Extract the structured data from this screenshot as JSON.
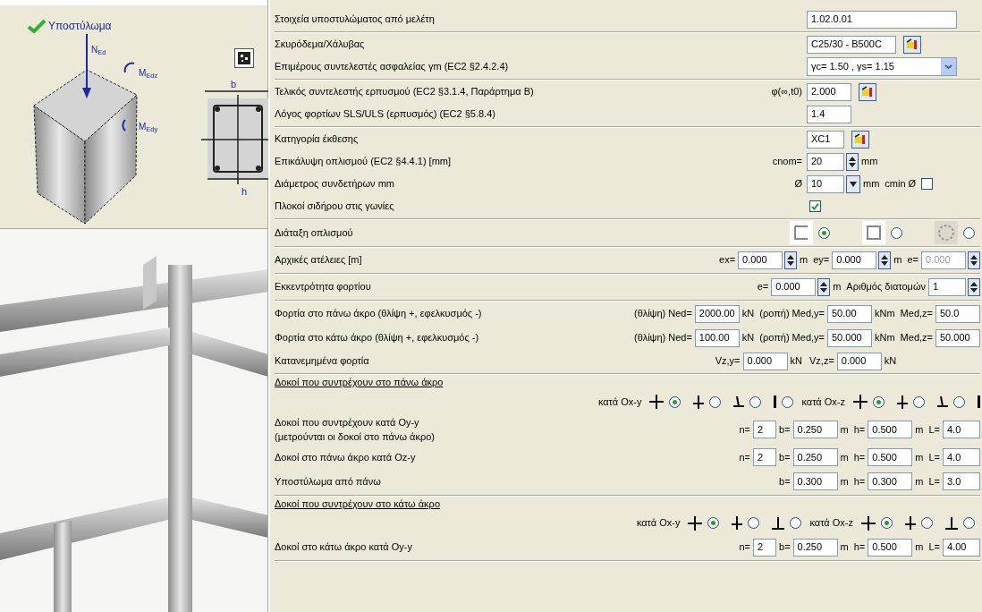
{
  "left_panel": {
    "title": "Υποστύλωμα",
    "drawing_labels": [
      "N$_{Ed}$",
      "M$_{Edz}$",
      "M$_{Edy}$"
    ],
    "section_labels": [
      "b",
      "h"
    ]
  },
  "groups": [
    {
      "rows": [
        {
          "kind": "setting",
          "label": "Στοιχεία υποστυλώματος από μελέτη",
          "pre": [],
          "main": [
            {
              "kind": "long_field",
              "value": "1.02.0.01",
              "disabled": false
            }
          ]
        }
      ]
    },
    {
      "rows": [
        {
          "kind": "setting",
          "label": "Σκυρόδεμα/Χάλυβας",
          "pre": [],
          "main": [
            {
              "kind": "medium_field",
              "value": "C25/30 - B500C",
              "disabled": false
            },
            {
              "kind": "button"
            }
          ]
        },
        {
          "kind": "setting",
          "label": "Επιμέρους συντελεστές ασφαλείας γm (EC2 §2.4.2.4)",
          "pre": [],
          "main": [
            {
              "kind": "dropdown",
              "value": "γc= 1.50 , γs= 1.15"
            }
          ]
        }
      ]
    },
    {
      "rows": [
        {
          "kind": "setting",
          "label": "Τελικός συντελεστής ερπυσμού (EC2 §3.1.4, Παράρτημα Β)",
          "pre": [
            {
              "kind": "text",
              "text": "φ(∞,t0)"
            }
          ],
          "main": [
            {
              "kind": "field",
              "value": "2.000",
              "disabled": false
            },
            {
              "kind": "button"
            }
          ]
        },
        {
          "kind": "setting",
          "label": "Λόγος φορτίων SLS/ULS (ερπυσμός) (EC2 §5.8.4)",
          "pre": [],
          "main": [
            {
              "kind": "field",
              "value": "1.4",
              "disabled": false
            }
          ]
        }
      ]
    },
    {
      "rows": [
        {
          "kind": "setting",
          "label": "Κατηγορία έκθεσης",
          "pre": [],
          "main": [
            {
              "kind": "short_field",
              "value": "XC1",
              "disabled": false
            },
            {
              "kind": "button"
            }
          ]
        },
        {
          "kind": "setting",
          "label": "Επικάλυψη οπλισμού (EC2 §4.4.1) [mm]",
          "pre": [
            {
              "kind": "text",
              "text": "cnom="
            }
          ],
          "main": [
            {
              "kind": "short_field",
              "value": "20",
              "disabled": false
            },
            {
              "kind": "spinner"
            },
            {
              "kind": "text",
              "text": "mm"
            }
          ]
        },
        {
          "kind": "setting",
          "label": "Διάμετρος συνδετήρων mm",
          "pre": [
            {
              "kind": "text",
              "text": "Ø"
            }
          ],
          "main": [
            {
              "kind": "short_field",
              "value": "10",
              "disabled": false
            },
            {
              "kind": "dropdown_button"
            },
            {
              "kind": "text",
              "text": "mm"
            },
            {
              "kind": "text",
              "text": "cmin Ø"
            },
            {
              "kind": "checkbox",
              "checked": false
            }
          ]
        },
        {
          "kind": "setting",
          "label": "Πλοκοί σιδήρου στις γωνίες",
          "pre": [],
          "main": [
            {
              "kind": "checkbox",
              "checked": true
            }
          ]
        }
      ]
    },
    {
      "rows": [
        {
          "kind": "wide",
          "label": "Διάταξη οπλισμού",
          "controls": [
            {
              "kind": "corner_layout"
            },
            {
              "kind": "radio",
              "selected": true
            },
            {
              "kind": "rect_layout"
            },
            {
              "kind": "radio",
              "selected": false
            },
            {
              "kind": "round_layout"
            },
            {
              "kind": "radio",
              "selected": false
            }
          ]
        }
      ]
    },
    {
      "rows": [
        {
          "kind": "wide",
          "label": "Αρχικές ατέλειες [m]",
          "controls": [
            {
              "kind": "text",
              "text": "ex="
            },
            {
              "kind": "field",
              "value": "0.000",
              "disabled": false
            },
            {
              "kind": "spinner"
            },
            {
              "kind": "text",
              "text": "m"
            },
            {
              "kind": "text",
              "text": "ey="
            },
            {
              "kind": "field",
              "value": "0.000",
              "disabled": false
            },
            {
              "kind": "spinner"
            },
            {
              "kind": "text",
              "text": "m"
            },
            {
              "kind": "text",
              "text": "e="
            },
            {
              "kind": "field",
              "value": "0.000",
              "disabled": true
            },
            {
              "kind": "spinner"
            }
          ]
        }
      ]
    },
    {
      "rows": [
        {
          "kind": "wide",
          "label": "Εκκεντρότητα φορτίου",
          "controls": [
            {
              "kind": "text",
              "text": "e="
            },
            {
              "kind": "field",
              "value": "0.000",
              "disabled": false
            },
            {
              "kind": "spinner"
            },
            {
              "kind": "text",
              "text": "m"
            },
            {
              "kind": "text",
              "text": "Αριθμός διατομών"
            },
            {
              "kind": "short_field",
              "value": "1",
              "disabled": false
            },
            {
              "kind": "spinner"
            }
          ]
        }
      ]
    },
    {
      "rows": [
        {
          "kind": "wide",
          "label": "Φορτία στο πάνω άκρο (θλίψη +, εφελκυσμός -)",
          "controls": [
            {
              "kind": "text",
              "text": "(θλίψη) Ned="
            },
            {
              "kind": "field",
              "value": "2000.00",
              "disabled": false
            },
            {
              "kind": "text",
              "text": "kN"
            },
            {
              "kind": "text",
              "text": "(ροπή) Med,y="
            },
            {
              "kind": "field",
              "value": "50.00",
              "disabled": false
            },
            {
              "kind": "text",
              "text": "kNm"
            },
            {
              "kind": "text",
              "text": "Med,z="
            },
            {
              "kind": "field",
              "value": "50.0",
              "disabled": false
            }
          ]
        },
        {
          "kind": "wide",
          "label": "Φορτία στο κάτω άκρο (θλίψη +, εφελκυσμός -)",
          "controls": [
            {
              "kind": "text",
              "text": "(θλίψη) Ned="
            },
            {
              "kind": "field",
              "value": "100.00",
              "disabled": false
            },
            {
              "kind": "text",
              "text": "kN"
            },
            {
              "kind": "text",
              "text": "(ροπή) Med,y="
            },
            {
              "kind": "field",
              "value": "50.000",
              "disabled": false
            },
            {
              "kind": "text",
              "text": "kNm"
            },
            {
              "kind": "text",
              "text": "Med,z="
            },
            {
              "kind": "field",
              "value": "50.000",
              "disabled": false
            }
          ]
        },
        {
          "kind": "setting",
          "label": "Κατανεμημένα φορτία",
          "pre": [
            {
              "kind": "text",
              "text": "Vz,y="
            },
            {
              "kind": "field",
              "value": "0.000",
              "disabled": false
            },
            {
              "kind": "text",
              "text": "kN"
            }
          ],
          "main": [
            {
              "kind": "text",
              "text": "Vz,z="
            },
            {
              "kind": "field",
              "value": "0.000",
              "disabled": false
            },
            {
              "kind": "text",
              "text": "kN"
            }
          ]
        }
      ]
    },
    {
      "heading": "Δοκοί που συντρέχουν στο πάνω άκρο",
      "rows": [
        {
          "kind": "wide",
          "controls": [
            {
              "kind": "text",
              "text": "κατά Ox-y"
            },
            {
              "kind": "cross_symbol"
            },
            {
              "kind": "radio",
              "selected": true
            },
            {
              "kind": "tee_symbol"
            },
            {
              "kind": "radio",
              "selected": false
            },
            {
              "kind": "slant_tee_symbol"
            },
            {
              "kind": "radio",
              "selected": false
            },
            {
              "kind": "bar_symbol"
            },
            {
              "kind": "radio",
              "selected": false
            },
            {
              "kind": "text",
              "text": "κατά Ox-z"
            },
            {
              "kind": "cross_symbol"
            },
            {
              "kind": "radio",
              "selected": true
            },
            {
              "kind": "tee_symbol"
            },
            {
              "kind": "radio",
              "selected": false
            },
            {
              "kind": "slant_tee_symbol"
            },
            {
              "kind": "radio",
              "selected": false
            },
            {
              "kind": "bar_symbol"
            }
          ]
        },
        {
          "kind": "wide",
          "label": "Δοκοί που συντρέχουν κατά Oy-y",
          "note": "(μετρούνται οι δοκοί στο πάνω άκρο)",
          "controls": [
            {
              "kind": "text",
              "text": "n="
            },
            {
              "kind": "tiny_field",
              "value": "2",
              "disabled": false
            },
            {
              "kind": "text",
              "text": "b="
            },
            {
              "kind": "field",
              "value": "0.250",
              "disabled": false
            },
            {
              "kind": "text",
              "text": "m"
            },
            {
              "kind": "text",
              "text": "h="
            },
            {
              "kind": "field",
              "value": "0.500",
              "disabled": false
            },
            {
              "kind": "text",
              "text": "m"
            },
            {
              "kind": "text",
              "text": "L="
            },
            {
              "kind": "short_field",
              "value": "4.0",
              "disabled": false
            }
          ]
        },
        {
          "kind": "wide",
          "label": "Δοκοί στο πάνω άκρο κατά Oz-y",
          "controls": [
            {
              "kind": "text",
              "text": "n="
            },
            {
              "kind": "tiny_field",
              "value": "2",
              "disabled": false
            },
            {
              "kind": "text",
              "text": "b="
            },
            {
              "kind": "field",
              "value": "0.250",
              "disabled": false
            },
            {
              "kind": "text",
              "text": "m"
            },
            {
              "kind": "text",
              "text": "h="
            },
            {
              "kind": "field",
              "value": "0.500",
              "disabled": false
            },
            {
              "kind": "text",
              "text": "m"
            },
            {
              "kind": "text",
              "text": "L="
            },
            {
              "kind": "short_field",
              "value": "4.0",
              "disabled": false
            }
          ]
        },
        {
          "kind": "wide",
          "label": "Υποστύλωμα από πάνω",
          "controls": [
            {
              "kind": "text",
              "text": "b="
            },
            {
              "kind": "field",
              "value": "0.300",
              "disabled": false
            },
            {
              "kind": "text",
              "text": "m"
            },
            {
              "kind": "text",
              "text": "h="
            },
            {
              "kind": "field",
              "value": "0.300",
              "disabled": false
            },
            {
              "kind": "text",
              "text": "m"
            },
            {
              "kind": "text",
              "text": "L="
            },
            {
              "kind": "short_field",
              "value": "3.0",
              "disabled": false
            }
          ]
        }
      ]
    },
    {
      "heading": "Δοκοί που συντρέχουν στο κάτω άκρο",
      "rows": [
        {
          "kind": "wide",
          "controls": [
            {
              "kind": "text",
              "text": "κατά Ox-y"
            },
            {
              "kind": "cross_symbol"
            },
            {
              "kind": "radio",
              "selected": true
            },
            {
              "kind": "tee_symbol"
            },
            {
              "kind": "radio",
              "selected": false
            },
            {
              "kind": "inverted_tee_symbol"
            },
            {
              "kind": "radio",
              "selected": false
            },
            {
              "kind": "text",
              "text": "κατά Ox-z"
            },
            {
              "kind": "cross_symbol"
            },
            {
              "kind": "radio",
              "selected": true
            },
            {
              "kind": "tee_symbol"
            },
            {
              "kind": "radio",
              "selected": false
            },
            {
              "kind": "inverted_tee_symbol"
            },
            {
              "kind": "radio",
              "selected": false
            }
          ]
        },
        {
          "kind": "wide",
          "label": "Δοκοί στο κάτω άκρο κατά Oy-y",
          "controls": [
            {
              "kind": "text",
              "text": "n="
            },
            {
              "kind": "tiny_field",
              "value": "2",
              "disabled": false
            },
            {
              "kind": "text",
              "text": "b="
            },
            {
              "kind": "field",
              "value": "0.250",
              "disabled": false
            },
            {
              "kind": "text",
              "text": "m"
            },
            {
              "kind": "text",
              "text": "h="
            },
            {
              "kind": "field",
              "value": "0.500",
              "disabled": false
            },
            {
              "kind": "text",
              "text": "m"
            },
            {
              "kind": "text",
              "text": "L="
            },
            {
              "kind": "short_field",
              "value": "4.00",
              "disabled": false
            }
          ]
        }
      ]
    }
  ]
}
